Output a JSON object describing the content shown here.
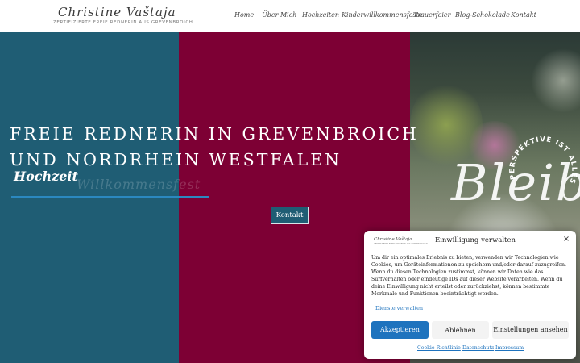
{
  "header": {
    "logo_script": "Christine Vaštaja",
    "logo_sub": "ZERTIFIZIERTE FREIE REDNERIN AUS GREVENBROICH"
  },
  "nav": {
    "items": [
      {
        "label": "Home"
      },
      {
        "label": "Über Mich"
      },
      {
        "label": "Hochzeiten"
      },
      {
        "label": "Kinderwillkommensfeste"
      },
      {
        "label": "Trauerfeier"
      },
      {
        "label": "Blog-Schokolade"
      },
      {
        "label": "Kontakt"
      }
    ]
  },
  "hero": {
    "title_line1": "FREIE REDNERIN IN GREVENBROICH",
    "title_line2": "UND NORDRHEIN WESTFALEN",
    "typed_active": "Hochzeit",
    "typed_ghost": "Willkommensfest",
    "contact_button": "Kontakt",
    "photo_script": "Bleib",
    "circle_text": "PERSPEKTIVE IST ALLES",
    "colors": {
      "teal": "#1f5d74",
      "wine": "#7d0034",
      "accent_line": "#2b88c0"
    }
  },
  "consent": {
    "logo_text": "Christine Vaštaja",
    "logo_sub": "ZERTIFIZIERTE FREIE REDNERIN AUS GREVENBROICH",
    "title": "Einwilligung verwalten",
    "close_icon": "×",
    "body": "Um dir ein optimales Erlebnis zu bieten, verwenden wir Technologien wie Cookies, um Geräteinformationen zu speichern und/oder darauf zuzugreifen. Wenn du diesen Technologien zustimmst, können wir Daten wie das Surfverhalten oder eindeutige IDs auf dieser Website verarbeiten. Wenn du deine Einwilligung nicht erteilst oder zurückziehst, können bestimmte Merkmale und Funktionen beeinträchtigt werden.",
    "vendors_link": "Dienste verwalten",
    "accept": "Akzeptieren",
    "deny": "Ablehnen",
    "settings": "Einstellungen ansehen",
    "footer_links": [
      {
        "label": "Cookie-Richtlinie"
      },
      {
        "label": "Datenschutz"
      },
      {
        "label": "Impressum"
      }
    ],
    "accent_color": "#1e73be"
  }
}
